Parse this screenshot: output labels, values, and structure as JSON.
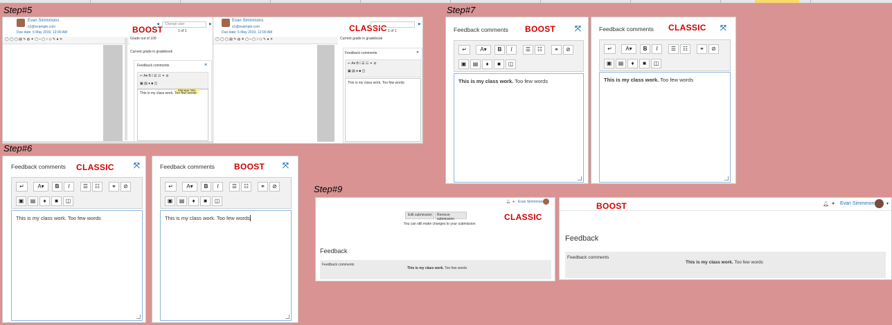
{
  "steps": {
    "s5": "Step#5",
    "s6": "Step#6",
    "s7": "Step#7",
    "s9": "Step#9"
  },
  "labels": {
    "boost": "BOOST",
    "classic": "CLASSIC"
  },
  "editor": {
    "title": "Feedback comments",
    "content_bold": "This is my class work.",
    "content_rest": " Too few words",
    "content_plain": "This is my class work. Too few words"
  },
  "grader": {
    "user_name": "Evan Simmmons",
    "user_email": "s1@example.com",
    "due_date": "Due date: 6 May 2019, 12:00 AM",
    "change_user": "Change user",
    "pagination": "1 of 1",
    "grade_out_of": "Grade out of 100",
    "current_grade": "Current grade in gradebook",
    "manage_files": "Manage files"
  },
  "step9": {
    "user_name": "Evan Simmmons",
    "edit_submission": "Edit submission",
    "remove_submission": "Remove submission",
    "can_still_change": "You can still make changes to your submission",
    "feedback_heading": "Feedback",
    "feedback_comments": "Feedback comments"
  }
}
